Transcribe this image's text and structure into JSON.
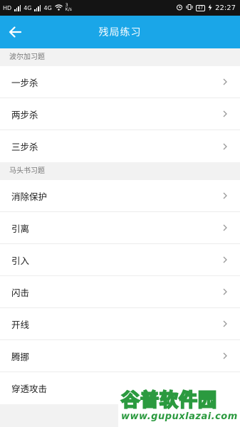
{
  "status_bar": {
    "left": [
      "HD",
      "4G",
      "4G",
      "3 K/s"
    ],
    "time": "22:27",
    "battery": "47"
  },
  "app_bar": {
    "title": "残局练习",
    "back_icon": "arrow-left-icon"
  },
  "sections": [
    {
      "header": "波尔加习题",
      "items": [
        "一步杀",
        "两步杀",
        "三步杀"
      ]
    },
    {
      "header": "马头书习题",
      "items": [
        "消除保护",
        "引离",
        "引入",
        "闪击",
        "开线",
        "腾挪",
        "穿透攻击"
      ]
    }
  ],
  "chevron_icon": "chevron-right-icon",
  "watermark": {
    "logo_text": "谷普软件园",
    "url": "www.gupuxlazai.com"
  },
  "colors": {
    "app_bar": "#1aa6e8",
    "background": "#f2f2f2",
    "watermark_green": "#2b9a3f"
  }
}
